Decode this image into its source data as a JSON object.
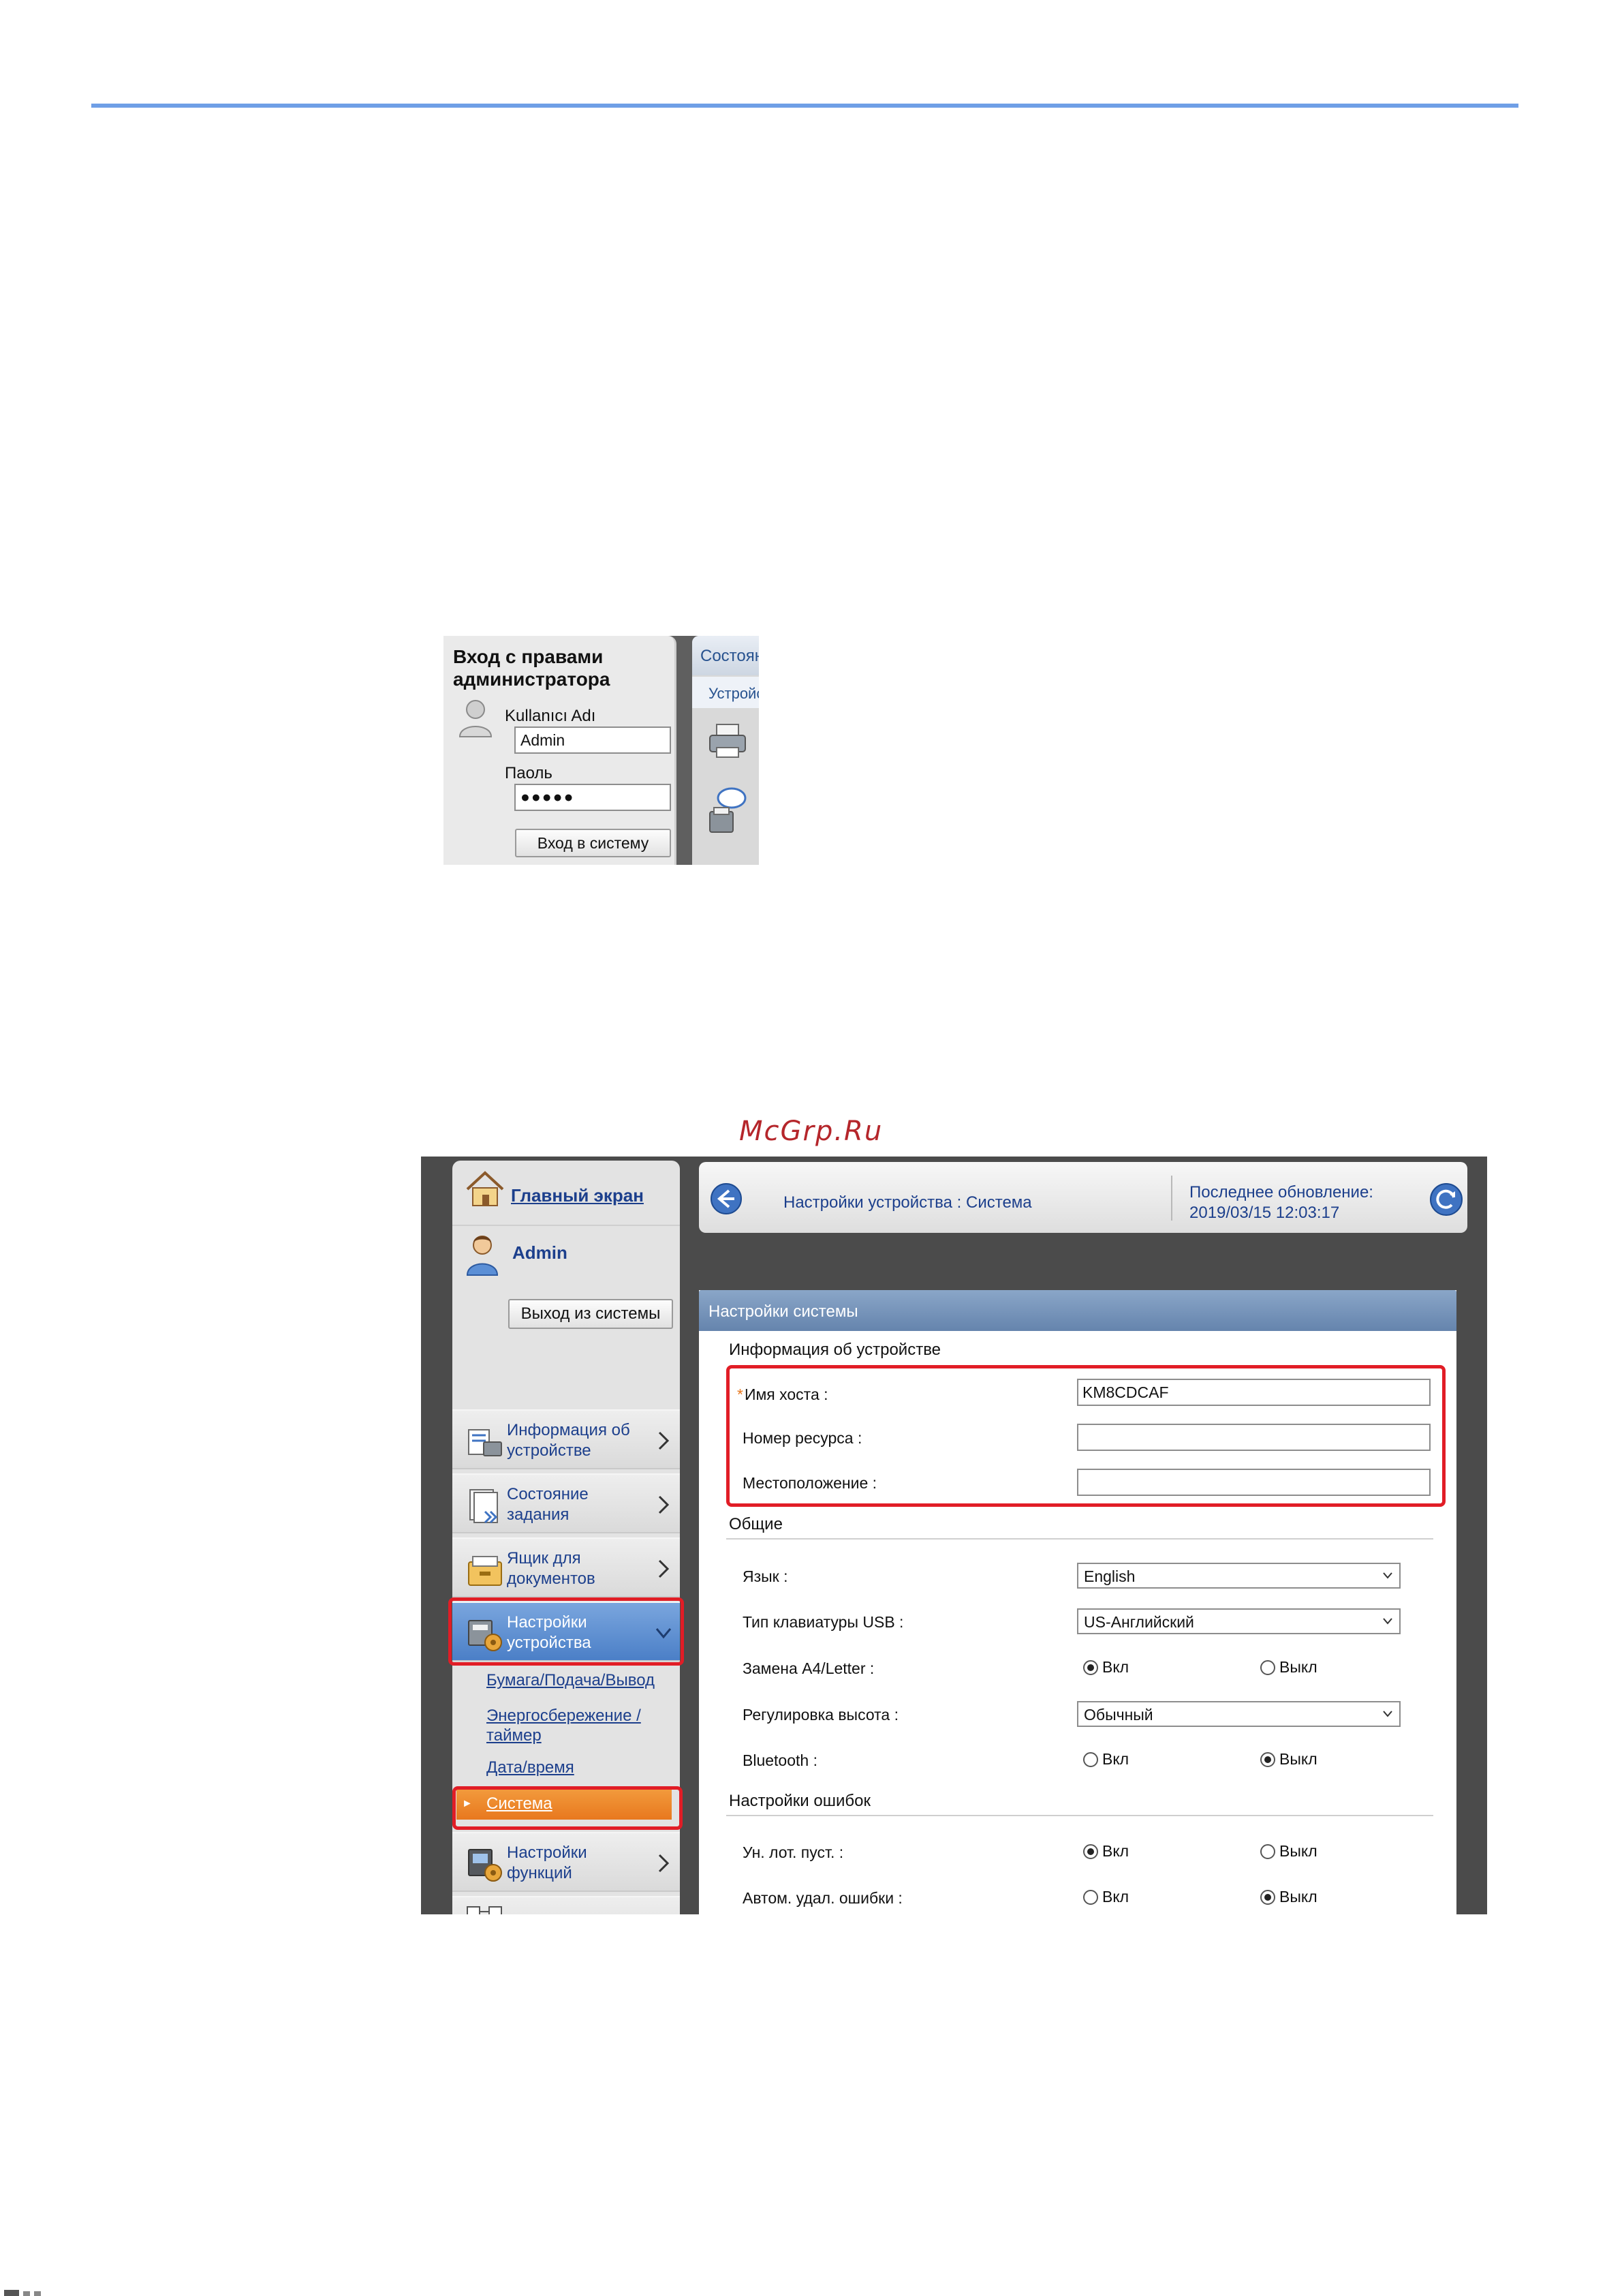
{
  "login": {
    "title": "Вход с правами администратора",
    "username_label": "Kullanıcı Adı",
    "username_value": "Admin",
    "password_label": "Паоль",
    "password_value": "●●●●●",
    "login_button": "Вход в систему",
    "tab_label": "Состояние",
    "subtab_label": "Устройство"
  },
  "watermark": "McGrp.Ru",
  "settings": {
    "sidebar": {
      "home_link": "Главный экран",
      "user_name": "Admin",
      "logout_button": "Выход из системы",
      "items": [
        {
          "label": "Информация об устройстве"
        },
        {
          "label": "Состояние задания"
        },
        {
          "label": "Ящик для документов"
        },
        {
          "label": "Настройки устройства"
        },
        {
          "label": "Настройки функций"
        }
      ],
      "sub_items": [
        {
          "label": "Бумага/Подача/Вывод"
        },
        {
          "label": "Энергосбережение / таймер"
        },
        {
          "label": "Дата/время"
        },
        {
          "label": "Система"
        }
      ]
    },
    "topbar": {
      "breadcrumb": "Настройки устройства : Система",
      "last_update_label": "Последнее обновление:",
      "last_update_value": "2019/03/15 12:03:17"
    },
    "panel_title": "Настройки системы",
    "device_info": {
      "title": "Информация об устройстве",
      "required_mark": "*",
      "host_label": "Имя хоста :",
      "host_value": "KM8CDCAF",
      "asset_label": "Номер ресурса :",
      "asset_value": "",
      "location_label": "Местоположение :",
      "location_value": ""
    },
    "general": {
      "title": "Общие",
      "language_label": "Язык :",
      "language_value": "English",
      "usb_kbd_label": "Тип клавиатуры USB :",
      "usb_kbd_value": "US-Английский",
      "a4_label": "Замена A4/Letter :",
      "altitude_label": "Регулировка высота :",
      "altitude_value": "Обычный",
      "bluetooth_label": "Bluetooth :"
    },
    "errors": {
      "title": "Настройки ошибок",
      "empty_tray_label": "Ун. лот. пуст. :",
      "auto_clear_label": "Автом. удал. ошибки :"
    },
    "radio": {
      "on": "Вкл",
      "off": "Выкл"
    }
  }
}
